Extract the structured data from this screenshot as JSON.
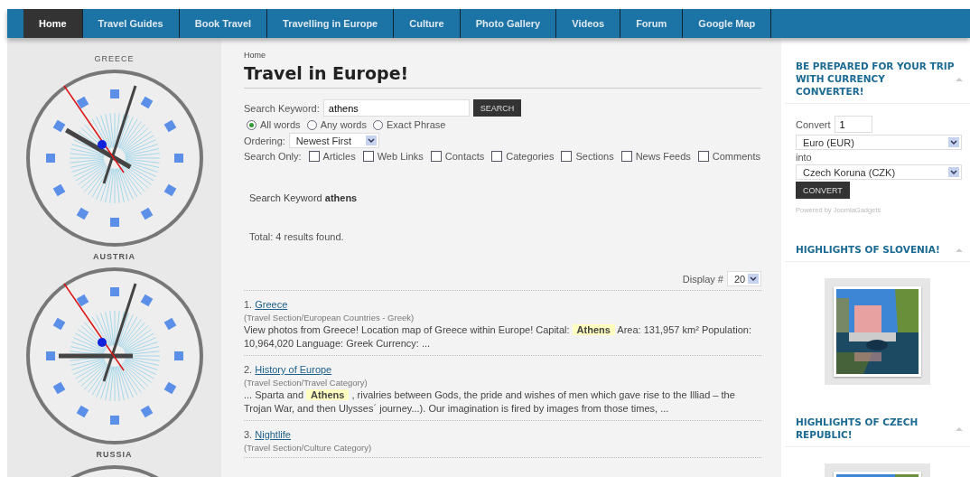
{
  "nav": [
    {
      "label": "Home",
      "selected": true
    },
    {
      "label": "Travel Guides",
      "selected": false
    },
    {
      "label": "Book Travel",
      "selected": false
    },
    {
      "label": "Travelling in Europe",
      "selected": false
    },
    {
      "label": "Culture",
      "selected": false
    },
    {
      "label": "Photo Gallery",
      "selected": false
    },
    {
      "label": "Videos",
      "selected": false
    },
    {
      "label": "Forum",
      "selected": false
    },
    {
      "label": "Google Map",
      "selected": false
    }
  ],
  "clocks": [
    {
      "label": "GREECE"
    },
    {
      "label": "AUSTRIA"
    },
    {
      "label": "RUSSIA"
    }
  ],
  "breadcrumb": "Home",
  "title": "Travel in Europe!",
  "search": {
    "label": "Search Keyword:",
    "value": "athens",
    "button": "SEARCH",
    "radios": [
      {
        "label": "All words",
        "selected": true
      },
      {
        "label": "Any words",
        "selected": false
      },
      {
        "label": "Exact Phrase",
        "selected": false
      }
    ],
    "ordering_label": "Ordering:",
    "ordering": "Newest First",
    "only_label": "Search Only:",
    "areas": [
      {
        "label": "Articles",
        "checked": false
      },
      {
        "label": "Web Links",
        "checked": false
      },
      {
        "label": "Contacts",
        "checked": false
      },
      {
        "label": "Categories",
        "checked": false
      },
      {
        "label": "Sections",
        "checked": false
      },
      {
        "label": "News Feeds",
        "checked": false
      },
      {
        "label": "Comments",
        "checked": false
      }
    ]
  },
  "summary": "Search Keyword **athens**",
  "total": "Total: 4 results found.",
  "display_label": "Display #",
  "display_value": "20",
  "results": [
    {
      "number": "1.",
      "title": "Greece",
      "category": "(Travel Section/European Countries - Greek)",
      "text": "View photos from Greece! Location map of Greece within Europe! Capital: **Athens** Area: 131,957 km² Population: 10,964,020 Language: Greek Currency: ..."
    },
    {
      "number": "2.",
      "title": "History of Europe",
      "category": "(Travel Section/Travel Category)",
      "text": "... Sparta and **Athens** , rivalries between Gods, the pride and wishes of men which gave rise to the Illiad – the Trojan War, and then Ulysses´ journey...). Our imagination is fired by images from those times, ..."
    },
    {
      "number": "3.",
      "title": "Nightlife",
      "category": "(Travel Section/Culture Category)"
    }
  ],
  "converter": {
    "title": "BE PREPARED FOR YOUR TRIP WITH CURRENCY CONVERTER!",
    "convert_label": "Convert",
    "amount": "1",
    "from": "Euro (EUR)",
    "into_label": "into",
    "to": "Czech Koruna (CZK)",
    "button": "CONVERT",
    "powered": "Powered by JoomlaGadgets"
  },
  "highlights": [
    {
      "title": "HIGHLIGHTS OF SLOVENIA!",
      "kind": "picture"
    },
    {
      "title": "HIGHLIGHTS OF CZECH REPUBLIC!",
      "kind": "picture"
    }
  ]
}
